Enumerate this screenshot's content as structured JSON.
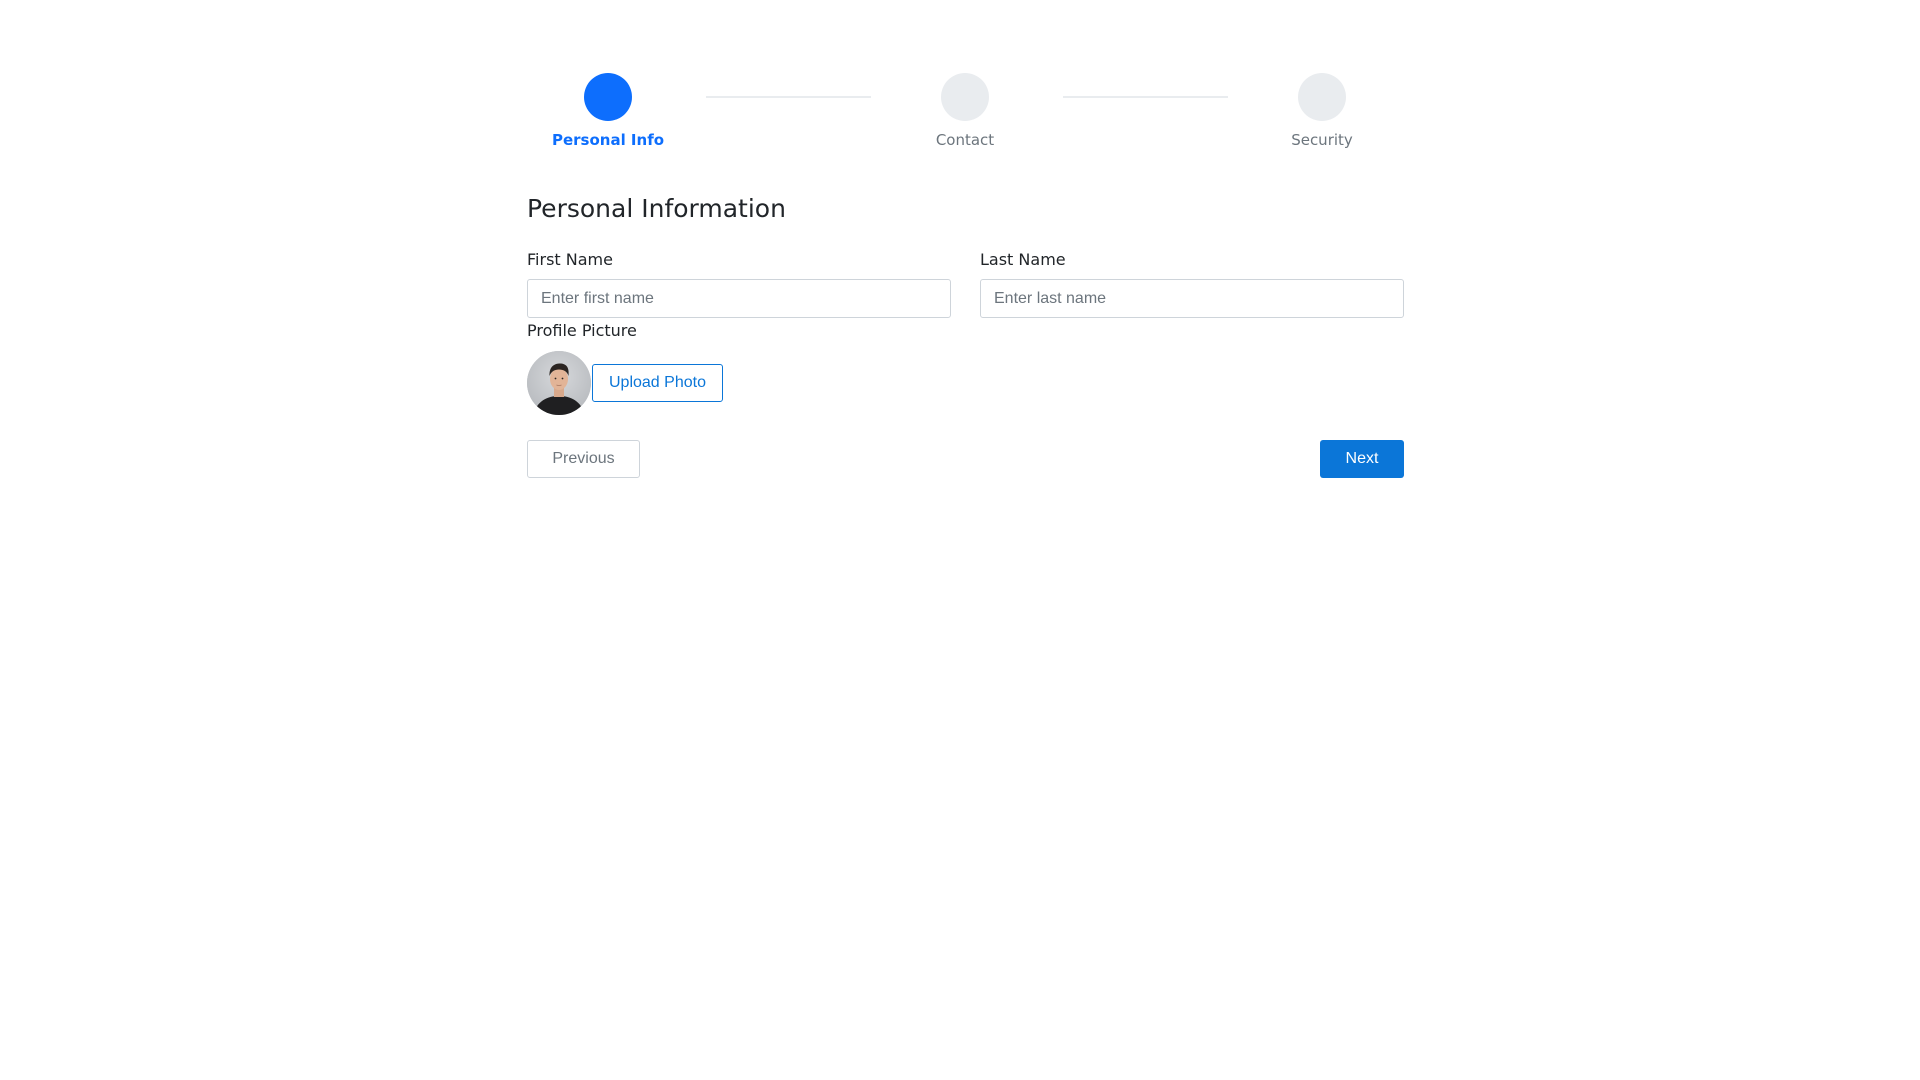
{
  "stepper": {
    "steps": [
      {
        "label": "Personal Info",
        "state": "active"
      },
      {
        "label": "Contact",
        "state": "inactive"
      },
      {
        "label": "Security",
        "state": "inactive"
      }
    ]
  },
  "form": {
    "title": "Personal Information",
    "first_name": {
      "label": "First Name",
      "placeholder": "Enter first name",
      "value": ""
    },
    "last_name": {
      "label": "Last Name",
      "placeholder": "Enter last name",
      "value": ""
    },
    "profile_picture": {
      "label": "Profile Picture",
      "upload_label": "Upload Photo"
    }
  },
  "navigation": {
    "previous_label": "Previous",
    "next_label": "Next"
  },
  "colors": {
    "accent": "#0d6efd",
    "button_primary": "#0b76d8",
    "step_inactive": "#e9ecef",
    "muted_text": "#6c757d"
  },
  "icons": {
    "avatar": "user-photo"
  }
}
